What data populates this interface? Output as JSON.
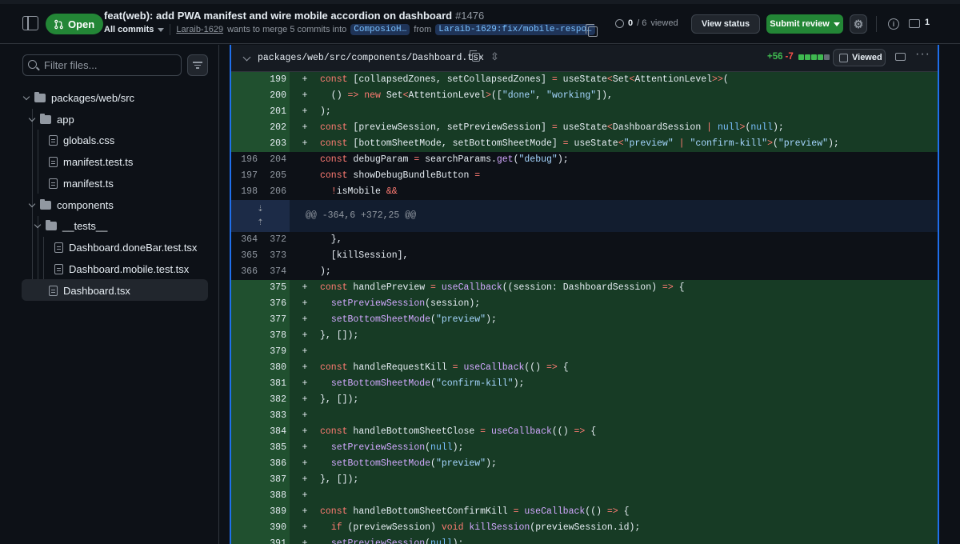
{
  "header": {
    "status": "Open",
    "title": "feat(web): add PWA manifest and wire mobile accordion on dashboard",
    "number": "#1476",
    "all_commits": "All commits",
    "author": "Laraib-1629",
    "merge_text": "wants to merge 5 commits into",
    "base_branch": "ComposioH…",
    "from_text": "from",
    "head_branch": "Laraib-1629:fix/mobile-respo…",
    "viewed_done": "0",
    "viewed_total": "/ 6",
    "viewed_label": "viewed",
    "view_status": "View status",
    "submit_review": "Submit review",
    "comment_count": "1",
    "info_glyph": "i"
  },
  "sidebar": {
    "filter_placeholder": "Filter files...",
    "tree": [
      {
        "label": "packages/web/src",
        "type": "folder"
      },
      {
        "label": "app",
        "type": "folder"
      },
      {
        "label": "globals.css",
        "type": "file"
      },
      {
        "label": "manifest.test.ts",
        "type": "file"
      },
      {
        "label": "manifest.ts",
        "type": "file"
      },
      {
        "label": "components",
        "type": "folder"
      },
      {
        "label": "__tests__",
        "type": "folder"
      },
      {
        "label": "Dashboard.doneBar.test.tsx",
        "type": "file"
      },
      {
        "label": "Dashboard.mobile.test.tsx",
        "type": "file"
      },
      {
        "label": "Dashboard.tsx",
        "type": "file",
        "selected": true
      }
    ]
  },
  "file": {
    "path": "packages/web/src/components/Dashboard.tsx",
    "additions": "+56",
    "deletions": "-7",
    "viewed_label": "Viewed",
    "more_glyph": "···",
    "expand_glyph": "⇳"
  },
  "colors": {
    "accent": "#1f6feb",
    "add": "#3fb950",
    "del": "#f85149",
    "open": "#238636"
  },
  "hunk": "@@ -364,6 +372,25 @@",
  "lines_a": [
    {
      "t": "add",
      "o": "",
      "n": "199",
      "c": "const [collapsedZones, setCollapsedZones] = useState<Set<AttentionLevel>>("
    },
    {
      "t": "add",
      "o": "",
      "n": "200",
      "c": "  () => new Set<AttentionLevel>([\"done\", \"working\"]),"
    },
    {
      "t": "add",
      "o": "",
      "n": "201",
      "c": ");"
    },
    {
      "t": "add",
      "o": "",
      "n": "202",
      "c": "const [previewSession, setPreviewSession] = useState<DashboardSession | null>(null);"
    },
    {
      "t": "add",
      "o": "",
      "n": "203",
      "c": "const [bottomSheetMode, setBottomSheetMode] = useState<\"preview\" | \"confirm-kill\">(\"preview\");"
    },
    {
      "t": "ctx",
      "o": "196",
      "n": "204",
      "c": "const debugParam = searchParams.get(\"debug\");"
    },
    {
      "t": "ctx",
      "o": "197",
      "n": "205",
      "c": "const showDebugBundleButton ="
    },
    {
      "t": "ctx",
      "o": "198",
      "n": "206",
      "c": "  !isMobile &&"
    }
  ],
  "lines_b": [
    {
      "t": "ctx",
      "o": "364",
      "n": "372",
      "c": "  },"
    },
    {
      "t": "ctx",
      "o": "365",
      "n": "373",
      "c": "  [killSession],"
    },
    {
      "t": "ctx",
      "o": "366",
      "n": "374",
      "c": ");"
    },
    {
      "t": "add",
      "o": "",
      "n": "375",
      "c": "const handlePreview = useCallback((session: DashboardSession) => {"
    },
    {
      "t": "add",
      "o": "",
      "n": "376",
      "c": "  setPreviewSession(session);"
    },
    {
      "t": "add",
      "o": "",
      "n": "377",
      "c": "  setBottomSheetMode(\"preview\");"
    },
    {
      "t": "add",
      "o": "",
      "n": "378",
      "c": "}, []);"
    },
    {
      "t": "add",
      "o": "",
      "n": "379",
      "c": ""
    },
    {
      "t": "add",
      "o": "",
      "n": "380",
      "c": "const handleRequestKill = useCallback(() => {"
    },
    {
      "t": "add",
      "o": "",
      "n": "381",
      "c": "  setBottomSheetMode(\"confirm-kill\");"
    },
    {
      "t": "add",
      "o": "",
      "n": "382",
      "c": "}, []);"
    },
    {
      "t": "add",
      "o": "",
      "n": "383",
      "c": ""
    },
    {
      "t": "add",
      "o": "",
      "n": "384",
      "c": "const handleBottomSheetClose = useCallback(() => {"
    },
    {
      "t": "add",
      "o": "",
      "n": "385",
      "c": "  setPreviewSession(null);"
    },
    {
      "t": "add",
      "o": "",
      "n": "386",
      "c": "  setBottomSheetMode(\"preview\");"
    },
    {
      "t": "add",
      "o": "",
      "n": "387",
      "c": "}, []);"
    },
    {
      "t": "add",
      "o": "",
      "n": "388",
      "c": ""
    },
    {
      "t": "add",
      "o": "",
      "n": "389",
      "c": "const handleBottomSheetConfirmKill = useCallback(() => {"
    },
    {
      "t": "add",
      "o": "",
      "n": "390",
      "c": "  if (previewSession) void killSession(previewSession.id);"
    },
    {
      "t": "add",
      "o": "",
      "n": "391",
      "c": "  setPreviewSession(null);"
    }
  ]
}
